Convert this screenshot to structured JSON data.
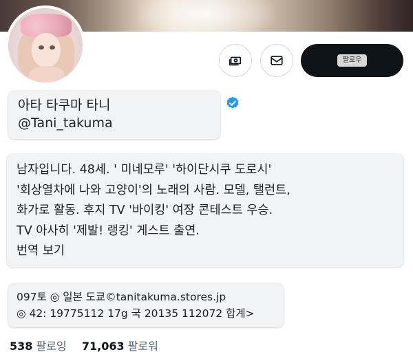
{
  "profile": {
    "display_name": "아타 타쿠마 타니",
    "handle": "@Tani_takuma"
  },
  "actions": {
    "tip_icon": "money-icon",
    "message_icon": "envelope-icon",
    "follow_label": "팔로우"
  },
  "bio": {
    "lines": [
      "남자입니다. 48세. ' 미네모루' '하이단시쿠 도로시'",
      "'회상열차에 나와 고양이'의 노래의 사람. 모델, 탤런트,",
      "화가로 활동. 후지 TV '바이킹' 여장 콘테스트 우승.",
      "TV 아사히 '제발! 랭킹' 게스트 출연.",
      "번역 보기"
    ]
  },
  "location": {
    "lines": [
      "097토 ◎ 일본 도쿄©tanitakuma.stores.jp",
      "◎ 42: 19775112 17g 국 20135 112072 합계>"
    ]
  },
  "stats": {
    "following_count": "538",
    "following_label": "팔로잉",
    "followers_count": "71,063",
    "followers_label": "팔로워"
  },
  "colors": {
    "follow_button_bg": "#0f1419",
    "verified_blue": "#1d9bf0",
    "card_bg": "#f2f3f5"
  }
}
